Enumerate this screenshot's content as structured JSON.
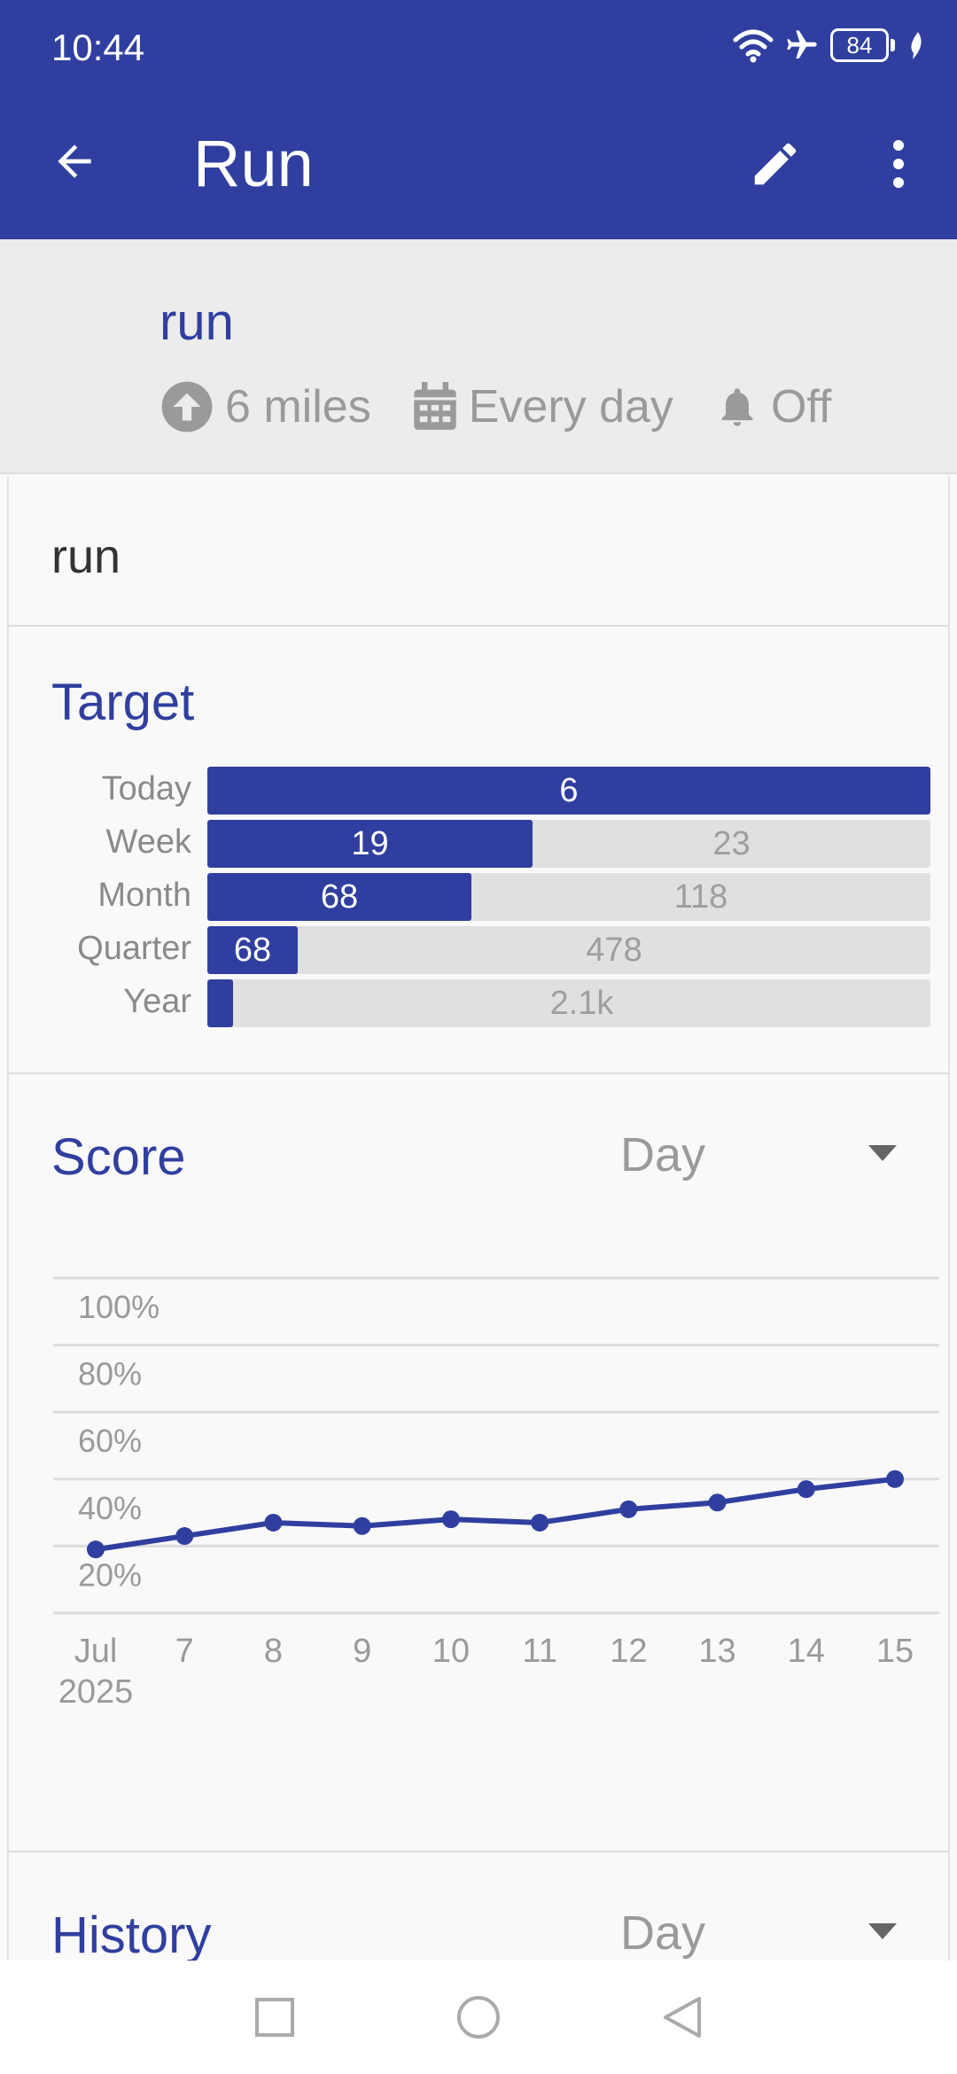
{
  "status_bar": {
    "time": "10:44",
    "battery": "84",
    "icons": [
      "wifi-icon",
      "airplane-icon",
      "battery-icon",
      "leaf-icon"
    ]
  },
  "app_bar": {
    "title": "Run",
    "back_icon": "arrow-left-icon",
    "edit_icon": "pencil-icon",
    "more_icon": "more-vert-icon",
    "background": "#303f9f"
  },
  "habit": {
    "name": "run",
    "target": "6 miles",
    "frequency": "Every day",
    "reminder": "Off"
  },
  "notes": "run",
  "target_section": {
    "title": "Target",
    "rows": [
      {
        "label": "Today",
        "done": 6,
        "done_text": "6",
        "remaining_text": "",
        "fraction": 1.0
      },
      {
        "label": "Week",
        "done": 19,
        "done_text": "19",
        "remaining_text": "23",
        "fraction": 0.45
      },
      {
        "label": "Month",
        "done": 68,
        "done_text": "68",
        "remaining_text": "118",
        "fraction": 0.365
      },
      {
        "label": "Quarter",
        "done": 68,
        "done_text": "68",
        "remaining_text": "478",
        "fraction": 0.125
      },
      {
        "label": "Year",
        "done_text": "",
        "remaining_text": "2.1k",
        "fraction": 0.035
      }
    ]
  },
  "score_section": {
    "title": "Score",
    "period": "Day"
  },
  "history_section": {
    "title": "History",
    "period": "Day"
  },
  "chart_data": {
    "type": "line",
    "title": "",
    "x": [
      "Jul\n2025",
      "7",
      "8",
      "9",
      "10",
      "11",
      "12",
      "13",
      "14",
      "15"
    ],
    "series": [
      {
        "values": [
          19,
          23,
          27,
          26,
          28,
          27,
          31,
          33,
          37,
          40
        ]
      }
    ],
    "ylim": [
      0,
      100
    ],
    "y_ticks": [
      "20%",
      "40%",
      "60%",
      "80%",
      "100%"
    ],
    "grid": true,
    "color": "#303f9f"
  },
  "nav_bar": {
    "icons": [
      "recents-square-icon",
      "home-circle-icon",
      "back-triangle-icon"
    ]
  }
}
